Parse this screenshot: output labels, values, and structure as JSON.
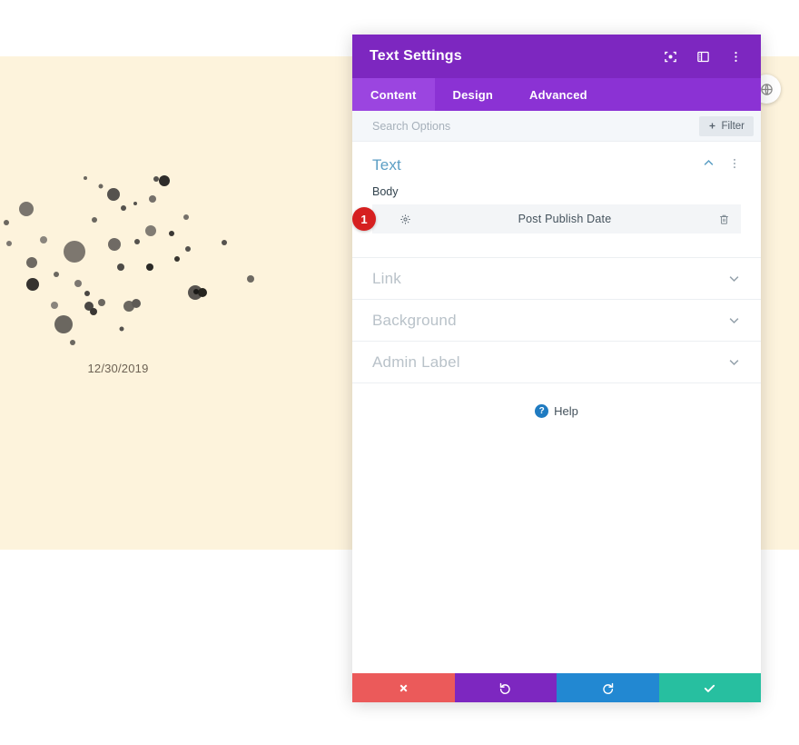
{
  "background": {
    "date_text": "12/30/2019",
    "colors": {
      "cream": "#fdf3dc",
      "white": "#ffffff"
    },
    "floating_button_icon": "globe-icon"
  },
  "panel": {
    "title": "Text Settings",
    "header_icons": [
      {
        "name": "focus-icon",
        "label": "Focus"
      },
      {
        "name": "layout-panel-icon",
        "label": "Panel Layout"
      },
      {
        "name": "more-vertical-icon",
        "label": "More Options"
      }
    ],
    "tabs": [
      {
        "label": "Content",
        "active": true
      },
      {
        "label": "Design",
        "active": false
      },
      {
        "label": "Advanced",
        "active": false
      }
    ],
    "search": {
      "placeholder": "Search Options",
      "value": ""
    },
    "filter_button": {
      "label": "Filter",
      "icon": "plus-icon"
    },
    "open_section": {
      "title": "Text",
      "collapse_icon": "chevron-up-icon",
      "menu_icon": "more-vertical-icon",
      "field_label": "Body",
      "item": {
        "badge": "1",
        "name": "Post Publish Date",
        "settings_icon": "gear-icon",
        "delete_icon": "trash-icon"
      }
    },
    "collapsed_sections": [
      {
        "label": "Link",
        "icon": "chevron-down-icon"
      },
      {
        "label": "Background",
        "icon": "chevron-down-icon"
      },
      {
        "label": "Admin Label",
        "icon": "chevron-down-icon"
      }
    ],
    "help": {
      "label": "Help",
      "icon": "question-circle-icon"
    },
    "footer_buttons": [
      {
        "name": "cancel",
        "icon": "close-icon",
        "color": "#eb5a5a"
      },
      {
        "name": "undo",
        "icon": "undo-icon",
        "color": "#7d27c0"
      },
      {
        "name": "redo",
        "icon": "redo-icon",
        "color": "#2288d2"
      },
      {
        "name": "save",
        "icon": "check-icon",
        "color": "#27bfa0"
      }
    ],
    "colors": {
      "header": "#7d27c0",
      "tabs": "#8b32d4",
      "tab_active": "#9b45e0"
    }
  }
}
